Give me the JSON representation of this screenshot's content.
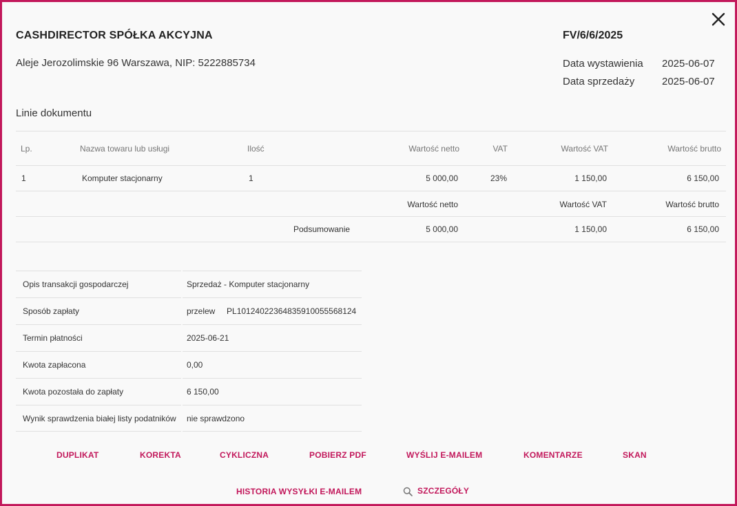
{
  "header": {
    "company": "CASHDIRECTOR SPÓŁKA AKCYJNA",
    "address": "Aleje Jerozolimskie 96 Warszawa, NIP: 5222885734",
    "document_number": "FV/6/6/2025",
    "issue_date_label": "Data wystawienia",
    "issue_date": "2025-06-07",
    "sale_date_label": "Data sprzedaży",
    "sale_date": "2025-06-07"
  },
  "lines": {
    "title": "Linie dokumentu",
    "columns": [
      "Lp.",
      "Nazwa towaru lub usługi",
      "Ilość",
      "Wartość netto",
      "VAT",
      "Wartość VAT",
      "Wartość brutto"
    ],
    "rows": [
      {
        "lp": "1",
        "name": "Komputer stacjonarny",
        "qty": "1",
        "net": "5 000,00",
        "vat": "23%",
        "vat_value": "1 150,00",
        "gross": "6 150,00"
      }
    ],
    "summary": {
      "label": "Podsumowanie",
      "net_label": "Wartość netto",
      "vat_label": "Wartość VAT",
      "gross_label": "Wartość brutto",
      "net": "5 000,00",
      "vat": "1 150,00",
      "gross": "6 150,00"
    }
  },
  "details": [
    {
      "key": "Opis transakcji gospodarczej",
      "value": "Sprzedaż - Komputer stacjonarny"
    },
    {
      "key": "Sposób zapłaty",
      "value": "przelew     PL10124022364835910055568124"
    },
    {
      "key": "Termin płatności",
      "value": "2025-06-21"
    },
    {
      "key": "Kwota zapłacona",
      "value": "0,00"
    },
    {
      "key": "Kwota pozostała do zapłaty",
      "value": "6 150,00"
    },
    {
      "key": "Wynik sprawdzenia białej listy podatników",
      "value": "nie sprawdzono"
    }
  ],
  "actions": {
    "duplicate": "DUPLIKAT",
    "correction": "KOREKTA",
    "recurring": "CYKLICZNA",
    "download_pdf": "POBIERZ PDF",
    "send_email": "WYŚLIJ E-MAILEM",
    "comments": "KOMENTARZE",
    "scan": "SKAN",
    "email_history": "HISTORIA WYSYŁKI E-MAILEM",
    "details": "SZCZEGÓŁY"
  },
  "colors": {
    "accent": "#c2185b",
    "border": "#c2185b",
    "divider": "#e0e0e0"
  },
  "icons": {
    "close": "close-icon",
    "search": "search-icon"
  }
}
